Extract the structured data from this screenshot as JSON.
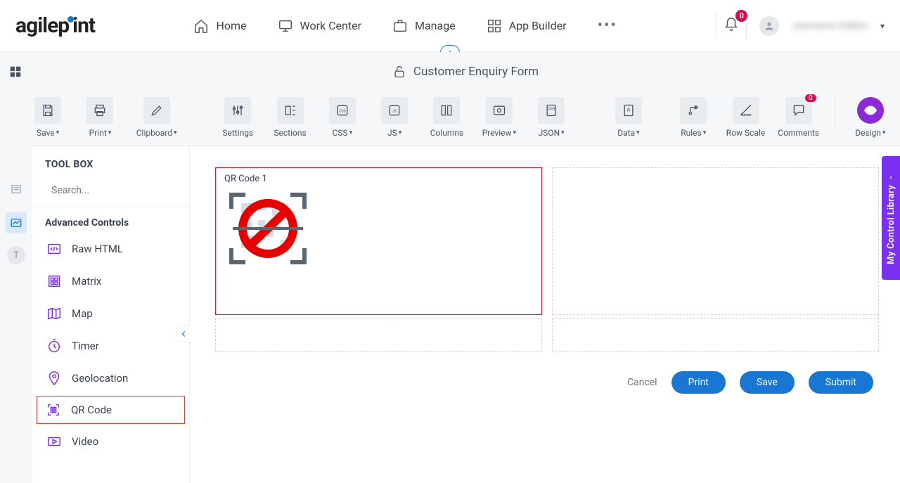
{
  "brand": "agilepoint",
  "nav": {
    "home": "Home",
    "work_center": "Work Center",
    "manage": "Manage",
    "app_builder": "App Builder"
  },
  "notifications": {
    "count": 0
  },
  "user": {
    "name": "username hidden"
  },
  "titlebar": {
    "form_title": "Customer Enquiry Form"
  },
  "toolbar": {
    "save": "Save",
    "print": "Print",
    "clipboard": "Clipboard",
    "settings": "Settings",
    "sections": "Sections",
    "css": "CSS",
    "js": "JS",
    "columns": "Columns",
    "preview": "Preview",
    "json": "JSON",
    "data": "Data",
    "rules": "Rules",
    "row_scale": "Row Scale",
    "comments": "Comments",
    "comment_count": 0,
    "design": "Design"
  },
  "toolbox": {
    "title": "TOOL BOX",
    "search_placeholder": "Search...",
    "group": "Advanced Controls",
    "items": [
      {
        "id": "raw-html",
        "label": "Raw HTML",
        "highlight": false
      },
      {
        "id": "matrix",
        "label": "Matrix",
        "highlight": false
      },
      {
        "id": "map",
        "label": "Map",
        "highlight": false
      },
      {
        "id": "timer",
        "label": "Timer",
        "highlight": false
      },
      {
        "id": "geolocation",
        "label": "Geolocation",
        "highlight": false
      },
      {
        "id": "qr-code",
        "label": "QR Code",
        "highlight": true
      },
      {
        "id": "video",
        "label": "Video",
        "highlight": false
      }
    ]
  },
  "canvas": {
    "control_label": "QR Code 1"
  },
  "buttons": {
    "cancel": "Cancel",
    "print": "Print",
    "save": "Save",
    "submit": "Submit"
  },
  "side_tab": {
    "label": "My Control Library"
  },
  "leftrail": {
    "t_label": "T"
  }
}
